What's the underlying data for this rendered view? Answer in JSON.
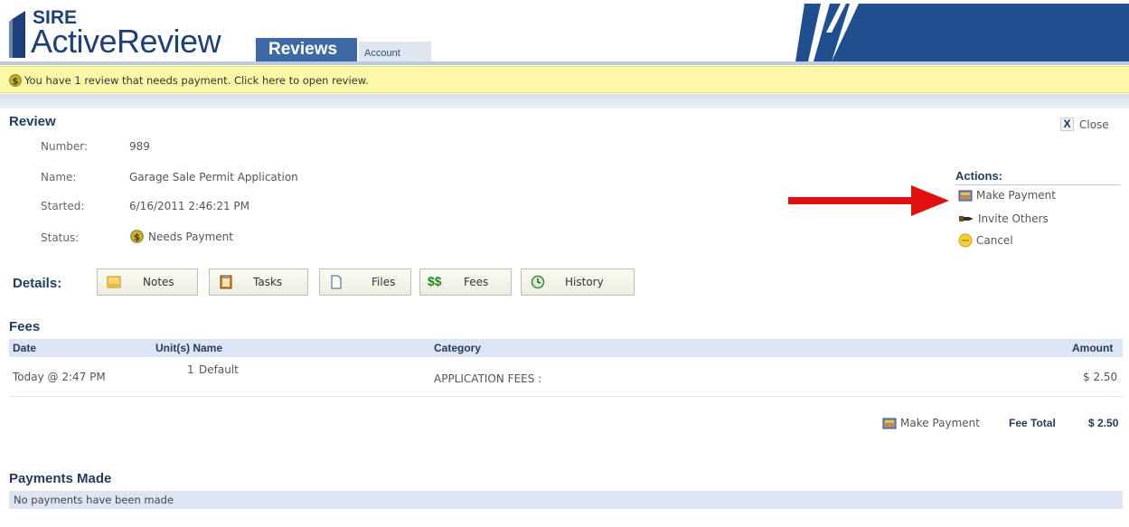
{
  "brand": {
    "top": "SIRE",
    "name": "ActiveReview"
  },
  "nav": {
    "tab_reviews": "Reviews",
    "tab_account": "Account"
  },
  "notice": {
    "text": "You have 1 review that needs payment. Click here to open review."
  },
  "review": {
    "title": "Review",
    "close_label": "Close",
    "number_label": "Number:",
    "number_value": "989",
    "name_label": "Name:",
    "name_value": "Garage Sale Permit Application",
    "started_label": "Started:",
    "started_value": "6/16/2011 2:46:21 PM",
    "status_label": "Status:",
    "status_value": "Needs Payment"
  },
  "actions": {
    "title": "Actions:",
    "make_payment": "Make Payment",
    "invite_others": "Invite Others",
    "cancel": "Cancel"
  },
  "details": {
    "label": "Details:",
    "buttons": [
      "Notes",
      "Tasks",
      "Files",
      "Fees",
      "History"
    ]
  },
  "fees": {
    "title": "Fees",
    "columns": {
      "date": "Date",
      "units_name": "Unit(s) Name",
      "category": "Category",
      "amount": "Amount"
    },
    "rows": [
      {
        "date": "Today @ 2:47 PM",
        "units": "1",
        "name": "Default",
        "category": "APPLICATION FEES :",
        "amount": "$ 2.50"
      }
    ],
    "make_payment": "Make Payment",
    "fee_total_label": "Fee Total",
    "fee_total_value": "$ 2.50"
  },
  "payments": {
    "title": "Payments Made",
    "empty_text": "No payments have been made"
  },
  "colors": {
    "brand_blue": "#1f3f78",
    "notice_yellow": "#fdf7a8",
    "arrow_red": "#e01010"
  }
}
